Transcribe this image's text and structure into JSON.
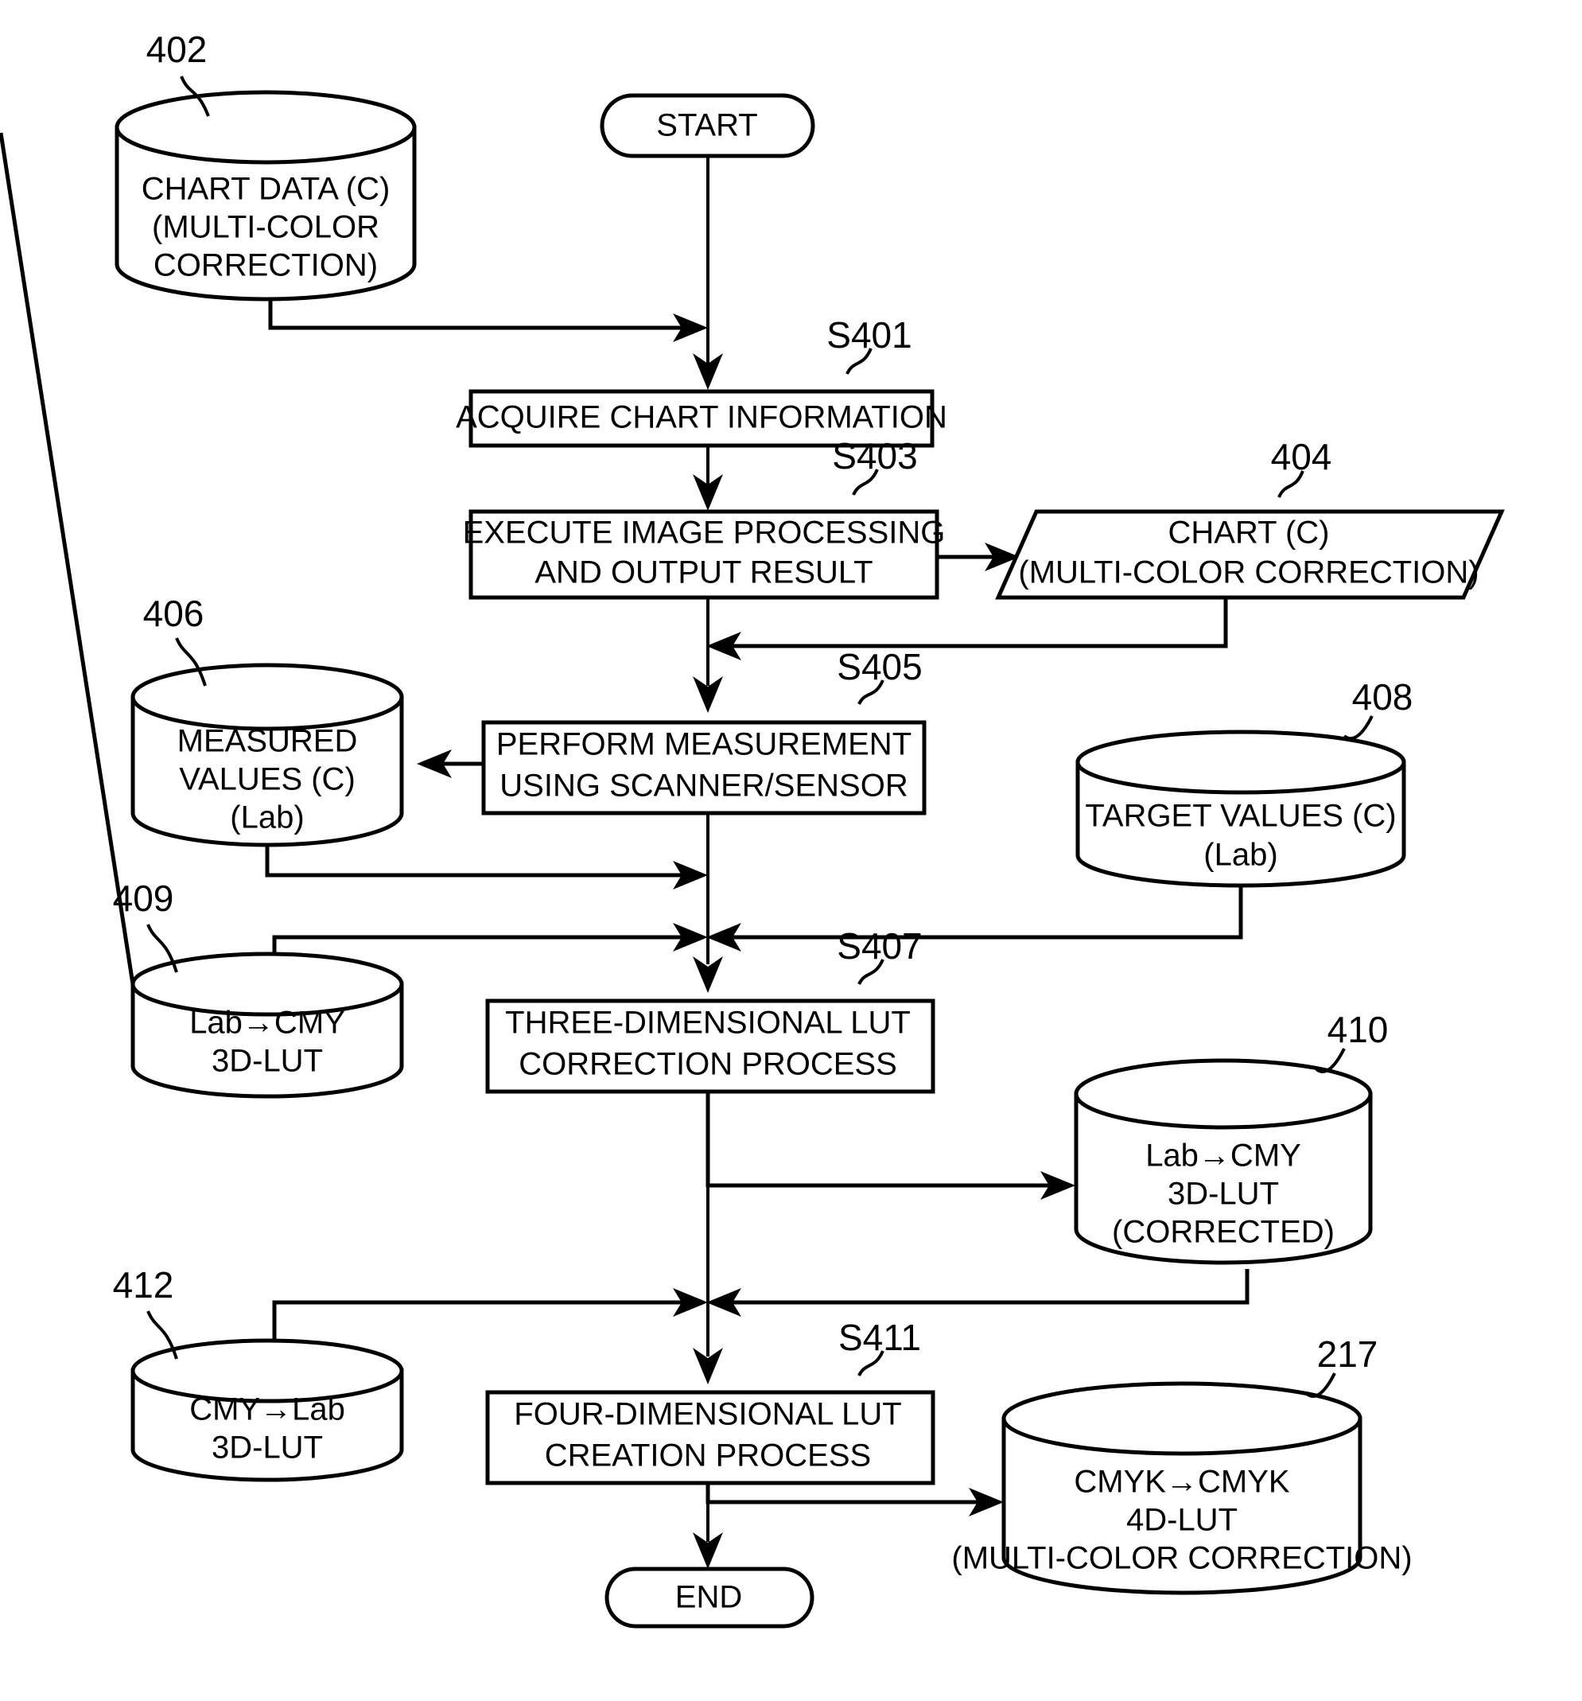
{
  "diagram": {
    "title": "Multi-color correction LUT creation flowchart",
    "terminals": {
      "start": "START",
      "end": "END"
    },
    "steps": [
      {
        "ref": "S401",
        "text_lines": [
          "ACQUIRE CHART INFORMATION"
        ]
      },
      {
        "ref": "S403",
        "text_lines": [
          "EXECUTE IMAGE PROCESSING",
          "AND OUTPUT RESULT"
        ]
      },
      {
        "ref": "S405",
        "text_lines": [
          "PERFORM MEASUREMENT",
          "USING SCANNER/SENSOR"
        ]
      },
      {
        "ref": "S407",
        "text_lines": [
          "THREE-DIMENSIONAL LUT",
          "CORRECTION PROCESS"
        ]
      },
      {
        "ref": "S411",
        "text_lines": [
          "FOUR-DIMENSIONAL LUT",
          "CREATION PROCESS"
        ]
      }
    ],
    "data_stores": [
      {
        "ref": "402",
        "text_lines": [
          "CHART DATA (C)",
          "(MULTI-COLOR",
          "CORRECTION)"
        ]
      },
      {
        "ref": "406",
        "text_lines": [
          "MEASURED",
          "VALUES (C)",
          "(Lab)"
        ]
      },
      {
        "ref": "408",
        "text_lines": [
          "TARGET VALUES (C)",
          "(Lab)"
        ]
      },
      {
        "ref": "409",
        "text_lines": [
          "Lab→CMY",
          "3D-LUT"
        ]
      },
      {
        "ref": "410",
        "text_lines": [
          "Lab→CMY",
          "3D-LUT",
          "(CORRECTED)"
        ]
      },
      {
        "ref": "412",
        "text_lines": [
          "CMY→Lab",
          "3D-LUT"
        ]
      },
      {
        "ref": "217",
        "text_lines": [
          "CMYK→CMYK",
          "4D-LUT",
          "(MULTI-COLOR CORRECTION)"
        ]
      }
    ],
    "documents": [
      {
        "ref": "404",
        "text_lines": [
          "CHART (C)",
          "(MULTI-COLOR CORRECTION)"
        ]
      }
    ],
    "colors": {
      "stroke": "#000000",
      "fill": "#ffffff",
      "text": "#000000"
    }
  },
  "text": {
    "start": "START",
    "end": "END",
    "s401_ref": "S401",
    "s401_l1": "ACQUIRE CHART INFORMATION",
    "s403_ref": "S403",
    "s403_l1": "EXECUTE IMAGE PROCESSING",
    "s403_l2": "AND OUTPUT RESULT",
    "s405_ref": "S405",
    "s405_l1": "PERFORM MEASUREMENT",
    "s405_l2": "USING SCANNER/SENSOR",
    "s407_ref": "S407",
    "s407_l1": "THREE-DIMENSIONAL LUT",
    "s407_l2": "CORRECTION PROCESS",
    "s411_ref": "S411",
    "s411_l1": "FOUR-DIMENSIONAL LUT",
    "s411_l2": "CREATION PROCESS",
    "r402": "402",
    "c402_l1": "CHART DATA (C)",
    "c402_l2": "(MULTI-COLOR",
    "c402_l3": "CORRECTION)",
    "r404": "404",
    "d404_l1": "CHART (C)",
    "d404_l2": "(MULTI-COLOR CORRECTION)",
    "r406": "406",
    "c406_l1": "MEASURED",
    "c406_l2": "VALUES (C)",
    "c406_l3": "(Lab)",
    "r408": "408",
    "c408_l1": "TARGET VALUES (C)",
    "c408_l2": "(Lab)",
    "r409": "409",
    "c409_l1": "Lab→CMY",
    "c409_l2": "3D-LUT",
    "r410": "410",
    "c410_l1": "Lab→CMY",
    "c410_l2": "3D-LUT",
    "c410_l3": "(CORRECTED)",
    "r412": "412",
    "c412_l1": "CMY→Lab",
    "c412_l2": "3D-LUT",
    "r217": "217",
    "c217_l1": "CMYK→CMYK",
    "c217_l2": "4D-LUT",
    "c217_l3": "(MULTI-COLOR CORRECTION)"
  }
}
